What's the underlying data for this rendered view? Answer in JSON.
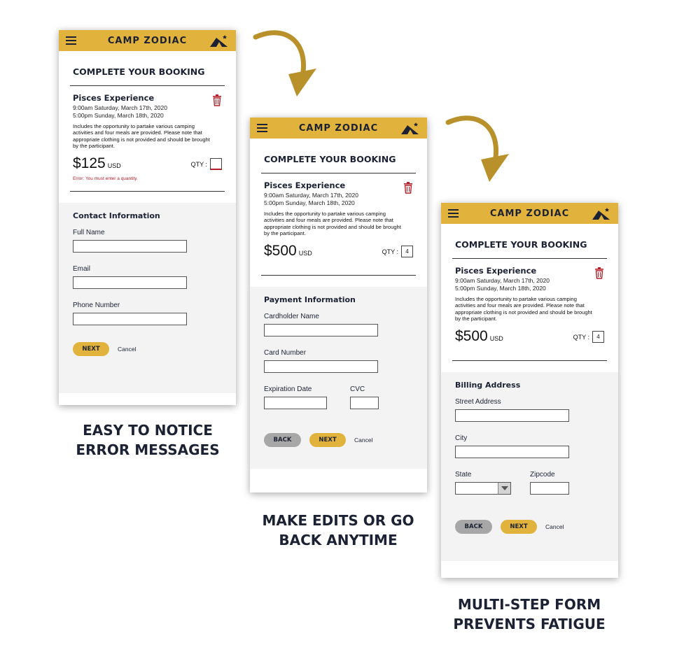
{
  "brand": "CAMP ZODIAC",
  "accent_color": "#e2b33c",
  "error_color": "#b5202a",
  "icons": [
    "hamburger-menu-icon",
    "tent-logo-icon",
    "trash-icon",
    "curved-arrow-icon",
    "chevron-down-icon"
  ],
  "booking": {
    "title": "COMPLETE YOUR BOOKING",
    "item_name": "Pisces Experience",
    "time_start": "9:00am Saturday, March 17th, 2020",
    "time_end": "5:00pm Sunday, March 18th, 2020",
    "description": "Includes the opportunity to partake various camping activities and four meals are provided. Please note that appropriate clothing is not provided and should be brought by the participant.",
    "currency": "USD",
    "qty_label": "QTY :"
  },
  "step1": {
    "price": "$125",
    "qty_value": "",
    "error": "Error: You must enter a quantity.",
    "form_title": "Contact Information",
    "fields": [
      "Full Name",
      "Email",
      "Phone Number"
    ],
    "next_label": "NEXT",
    "cancel_label": "Cancel",
    "caption_line1": "EASY TO NOTICE",
    "caption_line2": "ERROR MESSAGES"
  },
  "step2": {
    "price": "$500",
    "qty_value": "4",
    "form_title": "Payment Information",
    "fields": [
      "Cardholder Name",
      "Card Number",
      "Expiration Date",
      "CVC"
    ],
    "back_label": "BACK",
    "next_label": "NEXT",
    "cancel_label": "Cancel",
    "caption_line1": "MAKE EDITS OR GO",
    "caption_line2": "BACK ANYTIME"
  },
  "step3": {
    "price": "$500",
    "qty_value": "4",
    "form_title": "Billing Address",
    "fields": [
      "Street Address",
      "City",
      "State",
      "Zipcode"
    ],
    "back_label": "BACK",
    "next_label": "NEXT",
    "cancel_label": "Cancel",
    "caption_line1": "MULTI-STEP FORM",
    "caption_line2": "PREVENTS FATIGUE"
  }
}
